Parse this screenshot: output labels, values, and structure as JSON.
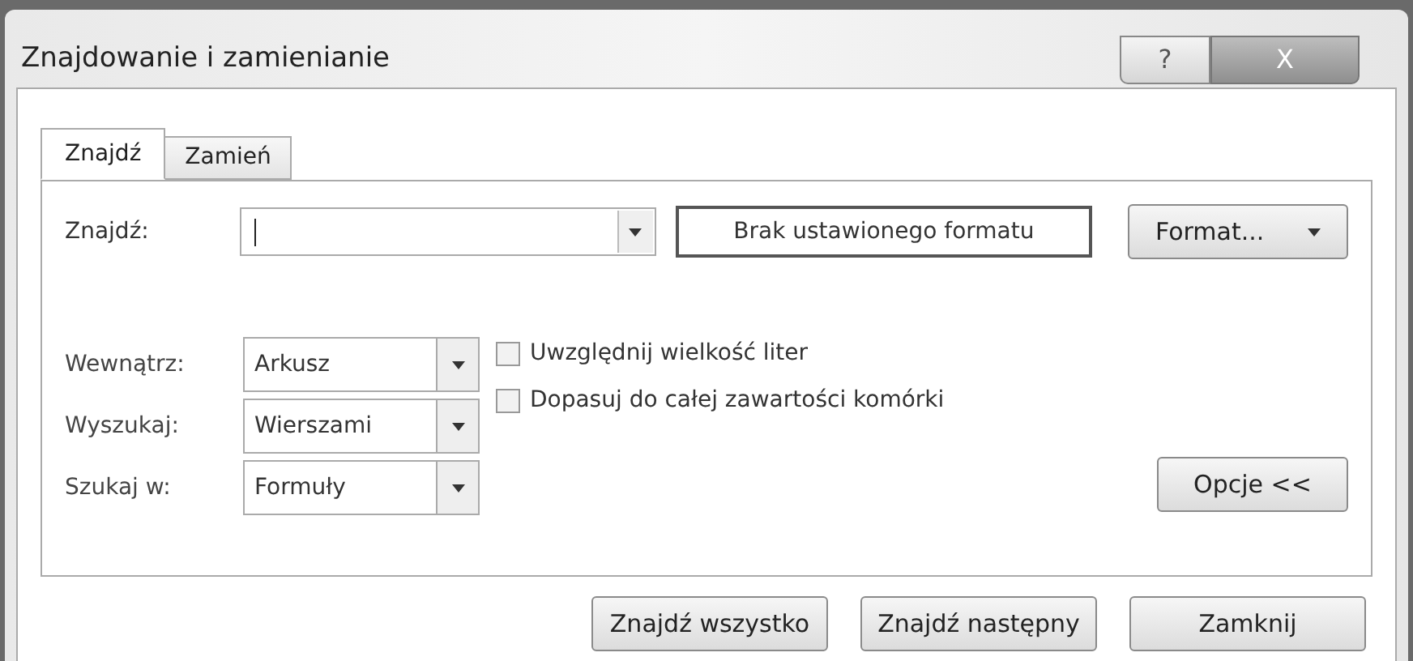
{
  "window": {
    "title": "Znajdowanie i zamienianie",
    "help_label": "?",
    "close_label": "X"
  },
  "tabs": [
    {
      "label": "Znajdź",
      "selected": true
    },
    {
      "label": "Zamień",
      "selected": false
    }
  ],
  "find": {
    "label": "Znajdź:",
    "format_preview": "Brak ustawionego formatu",
    "format_button": "Format..."
  },
  "options": [
    {
      "label": "Wewnątrz:",
      "value": "Arkusz"
    },
    {
      "label": "Wyszukaj:",
      "value": "Wierszami"
    },
    {
      "label": "Szukaj w:",
      "value": "Formuły"
    }
  ],
  "checkboxes": [
    {
      "label": "Uwzględnij wielkość liter",
      "checked": false
    },
    {
      "label": "Dopasuj do całej zawartości komórki",
      "checked": false
    }
  ],
  "options_button": "Opcje <<",
  "buttons": [
    "Znajdź wszystko",
    "Znajdź następny",
    "Zamknij"
  ]
}
